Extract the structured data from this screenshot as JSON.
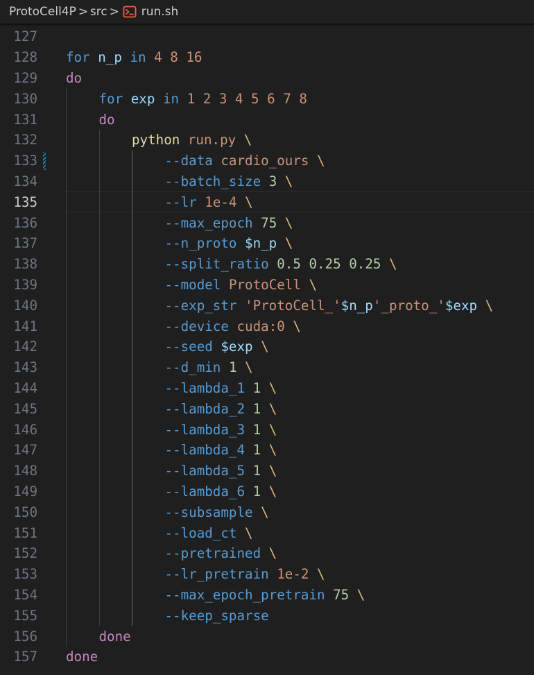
{
  "breadcrumb": {
    "project": "ProtoCell4P",
    "folder": "src",
    "file": "run.sh",
    "separator": ">"
  },
  "editor": {
    "current_line": 135,
    "lines": [
      {
        "n": "127",
        "tokens": []
      },
      {
        "n": "128",
        "tokens": [
          {
            "c": "t-kwb",
            "t": "for"
          },
          {
            "c": "t-plain",
            "t": " "
          },
          {
            "c": "t-var",
            "t": "n_p"
          },
          {
            "c": "t-plain",
            "t": " "
          },
          {
            "c": "t-kwb",
            "t": "in"
          },
          {
            "c": "t-plain",
            "t": " "
          },
          {
            "c": "t-num",
            "t": "4 8 16"
          }
        ]
      },
      {
        "n": "129",
        "tokens": [
          {
            "c": "t-kw",
            "t": "do"
          }
        ]
      },
      {
        "n": "130",
        "indent": 1,
        "tokens": [
          {
            "c": "t-kwb",
            "t": "for"
          },
          {
            "c": "t-plain",
            "t": " "
          },
          {
            "c": "t-var",
            "t": "exp"
          },
          {
            "c": "t-plain",
            "t": " "
          },
          {
            "c": "t-kwb",
            "t": "in"
          },
          {
            "c": "t-plain",
            "t": " "
          },
          {
            "c": "t-num",
            "t": "1 2 3 4 5 6 7 8"
          }
        ]
      },
      {
        "n": "131",
        "indent": 1,
        "tokens": [
          {
            "c": "t-kw",
            "t": "do"
          }
        ]
      },
      {
        "n": "132",
        "indent": 2,
        "tokens": [
          {
            "c": "t-cmd",
            "t": "python"
          },
          {
            "c": "t-plain",
            "t": " "
          },
          {
            "c": "t-arg",
            "t": "run.py"
          },
          {
            "c": "t-plain",
            "t": " "
          },
          {
            "c": "t-bs",
            "t": "\\"
          }
        ]
      },
      {
        "n": "133",
        "indent": 3,
        "mod": true,
        "tokens": [
          {
            "c": "t-flag",
            "t": "--data"
          },
          {
            "c": "t-plain",
            "t": " "
          },
          {
            "c": "t-arg",
            "t": "cardio_ours"
          },
          {
            "c": "t-plain",
            "t": " "
          },
          {
            "c": "t-bs",
            "t": "\\"
          }
        ]
      },
      {
        "n": "134",
        "indent": 3,
        "tokens": [
          {
            "c": "t-flag",
            "t": "--batch_size"
          },
          {
            "c": "t-plain",
            "t": " "
          },
          {
            "c": "t-numg",
            "t": "3"
          },
          {
            "c": "t-plain",
            "t": " "
          },
          {
            "c": "t-bs",
            "t": "\\"
          }
        ]
      },
      {
        "n": "135",
        "indent": 3,
        "tokens": [
          {
            "c": "t-flag",
            "t": "--lr"
          },
          {
            "c": "t-plain",
            "t": " "
          },
          {
            "c": "t-arg",
            "t": "1e-4"
          },
          {
            "c": "t-plain",
            "t": " "
          },
          {
            "c": "t-bs",
            "t": "\\"
          }
        ]
      },
      {
        "n": "136",
        "indent": 3,
        "tokens": [
          {
            "c": "t-flag",
            "t": "--max_epoch"
          },
          {
            "c": "t-plain",
            "t": " "
          },
          {
            "c": "t-numg",
            "t": "75"
          },
          {
            "c": "t-plain",
            "t": " "
          },
          {
            "c": "t-bs",
            "t": "\\"
          }
        ]
      },
      {
        "n": "137",
        "indent": 3,
        "tokens": [
          {
            "c": "t-flag",
            "t": "--n_proto"
          },
          {
            "c": "t-plain",
            "t": " "
          },
          {
            "c": "t-var",
            "t": "$n_p"
          },
          {
            "c": "t-plain",
            "t": " "
          },
          {
            "c": "t-bs",
            "t": "\\"
          }
        ]
      },
      {
        "n": "138",
        "indent": 3,
        "tokens": [
          {
            "c": "t-flag",
            "t": "--split_ratio"
          },
          {
            "c": "t-plain",
            "t": " "
          },
          {
            "c": "t-numg",
            "t": "0.5 0.25 0.25"
          },
          {
            "c": "t-plain",
            "t": " "
          },
          {
            "c": "t-bs",
            "t": "\\"
          }
        ]
      },
      {
        "n": "139",
        "indent": 3,
        "tokens": [
          {
            "c": "t-flag",
            "t": "--model"
          },
          {
            "c": "t-plain",
            "t": " "
          },
          {
            "c": "t-arg",
            "t": "ProtoCell"
          },
          {
            "c": "t-plain",
            "t": " "
          },
          {
            "c": "t-bs",
            "t": "\\"
          }
        ]
      },
      {
        "n": "140",
        "indent": 3,
        "tokens": [
          {
            "c": "t-flag",
            "t": "--exp_str"
          },
          {
            "c": "t-plain",
            "t": " "
          },
          {
            "c": "t-str",
            "t": "'ProtoCell_'"
          },
          {
            "c": "t-var",
            "t": "$n_p"
          },
          {
            "c": "t-str",
            "t": "'_proto_'"
          },
          {
            "c": "t-var",
            "t": "$exp"
          },
          {
            "c": "t-plain",
            "t": " "
          },
          {
            "c": "t-bs",
            "t": "\\"
          }
        ]
      },
      {
        "n": "141",
        "indent": 3,
        "tokens": [
          {
            "c": "t-flag",
            "t": "--device"
          },
          {
            "c": "t-plain",
            "t": " "
          },
          {
            "c": "t-arg",
            "t": "cuda:0"
          },
          {
            "c": "t-plain",
            "t": " "
          },
          {
            "c": "t-bs",
            "t": "\\"
          }
        ]
      },
      {
        "n": "142",
        "indent": 3,
        "tokens": [
          {
            "c": "t-flag",
            "t": "--seed"
          },
          {
            "c": "t-plain",
            "t": " "
          },
          {
            "c": "t-var",
            "t": "$exp"
          },
          {
            "c": "t-plain",
            "t": " "
          },
          {
            "c": "t-bs",
            "t": "\\"
          }
        ]
      },
      {
        "n": "143",
        "indent": 3,
        "tokens": [
          {
            "c": "t-flag",
            "t": "--d_min"
          },
          {
            "c": "t-plain",
            "t": " "
          },
          {
            "c": "t-numg",
            "t": "1"
          },
          {
            "c": "t-plain",
            "t": " "
          },
          {
            "c": "t-bs",
            "t": "\\"
          }
        ]
      },
      {
        "n": "144",
        "indent": 3,
        "tokens": [
          {
            "c": "t-flag",
            "t": "--lambda_1"
          },
          {
            "c": "t-plain",
            "t": " "
          },
          {
            "c": "t-numg",
            "t": "1"
          },
          {
            "c": "t-plain",
            "t": " "
          },
          {
            "c": "t-bs",
            "t": "\\"
          }
        ]
      },
      {
        "n": "145",
        "indent": 3,
        "tokens": [
          {
            "c": "t-flag",
            "t": "--lambda_2"
          },
          {
            "c": "t-plain",
            "t": " "
          },
          {
            "c": "t-numg",
            "t": "1"
          },
          {
            "c": "t-plain",
            "t": " "
          },
          {
            "c": "t-bs",
            "t": "\\"
          }
        ]
      },
      {
        "n": "146",
        "indent": 3,
        "tokens": [
          {
            "c": "t-flag",
            "t": "--lambda_3"
          },
          {
            "c": "t-plain",
            "t": " "
          },
          {
            "c": "t-numg",
            "t": "1"
          },
          {
            "c": "t-plain",
            "t": " "
          },
          {
            "c": "t-bs",
            "t": "\\"
          }
        ]
      },
      {
        "n": "147",
        "indent": 3,
        "tokens": [
          {
            "c": "t-flag",
            "t": "--lambda_4"
          },
          {
            "c": "t-plain",
            "t": " "
          },
          {
            "c": "t-numg",
            "t": "1"
          },
          {
            "c": "t-plain",
            "t": " "
          },
          {
            "c": "t-bs",
            "t": "\\"
          }
        ]
      },
      {
        "n": "148",
        "indent": 3,
        "tokens": [
          {
            "c": "t-flag",
            "t": "--lambda_5"
          },
          {
            "c": "t-plain",
            "t": " "
          },
          {
            "c": "t-numg",
            "t": "1"
          },
          {
            "c": "t-plain",
            "t": " "
          },
          {
            "c": "t-bs",
            "t": "\\"
          }
        ]
      },
      {
        "n": "149",
        "indent": 3,
        "tokens": [
          {
            "c": "t-flag",
            "t": "--lambda_6"
          },
          {
            "c": "t-plain",
            "t": " "
          },
          {
            "c": "t-numg",
            "t": "1"
          },
          {
            "c": "t-plain",
            "t": " "
          },
          {
            "c": "t-bs",
            "t": "\\"
          }
        ]
      },
      {
        "n": "150",
        "indent": 3,
        "tokens": [
          {
            "c": "t-flag",
            "t": "--subsample"
          },
          {
            "c": "t-plain",
            "t": " "
          },
          {
            "c": "t-bs",
            "t": "\\"
          }
        ]
      },
      {
        "n": "151",
        "indent": 3,
        "tokens": [
          {
            "c": "t-flag",
            "t": "--load_ct"
          },
          {
            "c": "t-plain",
            "t": " "
          },
          {
            "c": "t-bs",
            "t": "\\"
          }
        ]
      },
      {
        "n": "152",
        "indent": 3,
        "tokens": [
          {
            "c": "t-flag",
            "t": "--pretrained"
          },
          {
            "c": "t-plain",
            "t": " "
          },
          {
            "c": "t-bs",
            "t": "\\"
          }
        ]
      },
      {
        "n": "153",
        "indent": 3,
        "tokens": [
          {
            "c": "t-flag",
            "t": "--lr_pretrain"
          },
          {
            "c": "t-plain",
            "t": " "
          },
          {
            "c": "t-arg",
            "t": "1e-2"
          },
          {
            "c": "t-plain",
            "t": " "
          },
          {
            "c": "t-bs",
            "t": "\\"
          }
        ]
      },
      {
        "n": "154",
        "indent": 3,
        "tokens": [
          {
            "c": "t-flag",
            "t": "--max_epoch_pretrain"
          },
          {
            "c": "t-plain",
            "t": " "
          },
          {
            "c": "t-numg",
            "t": "75"
          },
          {
            "c": "t-plain",
            "t": " "
          },
          {
            "c": "t-bs",
            "t": "\\"
          }
        ]
      },
      {
        "n": "155",
        "indent": 3,
        "tokens": [
          {
            "c": "t-flag",
            "t": "--keep_sparse"
          }
        ]
      },
      {
        "n": "156",
        "indent": 1,
        "tokens": [
          {
            "c": "t-kw",
            "t": "done"
          }
        ]
      },
      {
        "n": "157",
        "tokens": [
          {
            "c": "t-kw",
            "t": "done"
          }
        ]
      }
    ]
  }
}
